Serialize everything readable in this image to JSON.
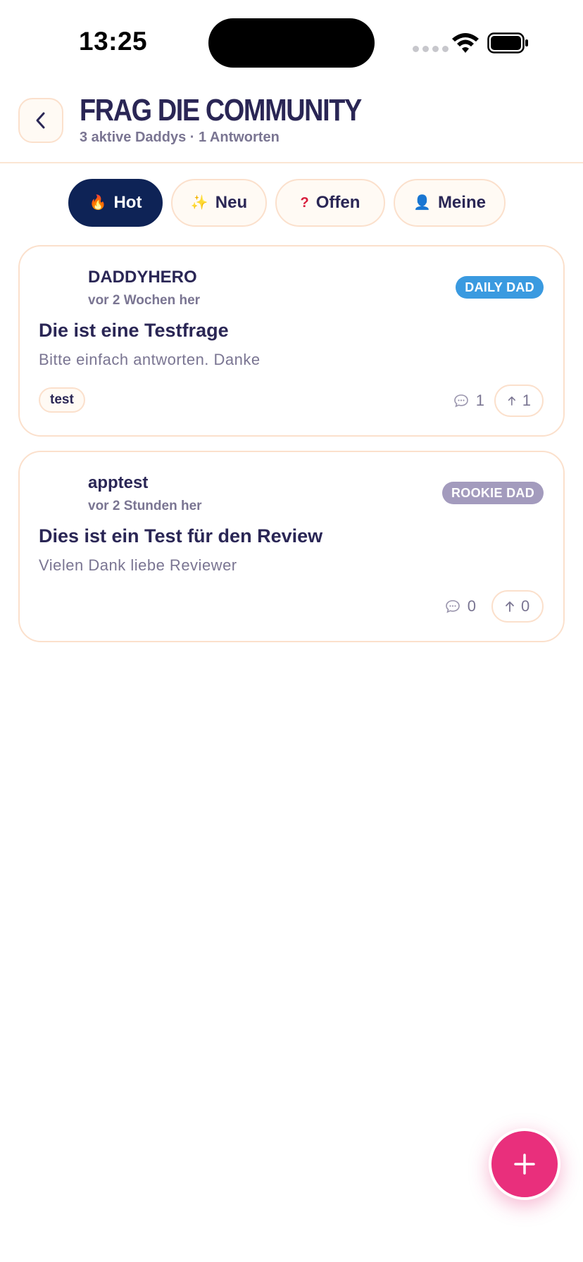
{
  "status_bar": {
    "time": "13:25"
  },
  "header": {
    "title": "FRAG DIE COMMUNITY",
    "subtitle": "3 aktive Daddys · 1 Antworten"
  },
  "filters": [
    {
      "label": "Hot",
      "icon": "fire-icon",
      "emoji": "🔥",
      "active": true
    },
    {
      "label": "Neu",
      "icon": "sparkles-icon",
      "emoji": "✨",
      "active": false
    },
    {
      "label": "Offen",
      "icon": "question-icon",
      "emoji": "?",
      "active": false
    },
    {
      "label": "Meine",
      "icon": "user-icon",
      "emoji": "👤",
      "active": false
    }
  ],
  "posts": [
    {
      "author": "DADDYHERO",
      "time_ago": "vor 2 Wochen her",
      "badge": "DAILY DAD",
      "title": "Die ist eine Testfrage",
      "body": "Bitte einfach antworten. Danke",
      "tag": "test",
      "comments": "1",
      "upvotes": "1"
    },
    {
      "author": "apptest",
      "time_ago": "vor 2 Stunden her",
      "badge": "ROOKIE DAD",
      "title": "Dies ist ein Test für den Review",
      "body": "Vielen Dank liebe Reviewer",
      "tag": "",
      "comments": "0",
      "upvotes": "0"
    }
  ],
  "colors": {
    "primary_navy": "#0e2356",
    "accent_pink": "#e92f7c",
    "badge_daily": "#3a9ae0",
    "badge_rookie": "#a39bbd",
    "border_peach": "#fbe0cc"
  }
}
